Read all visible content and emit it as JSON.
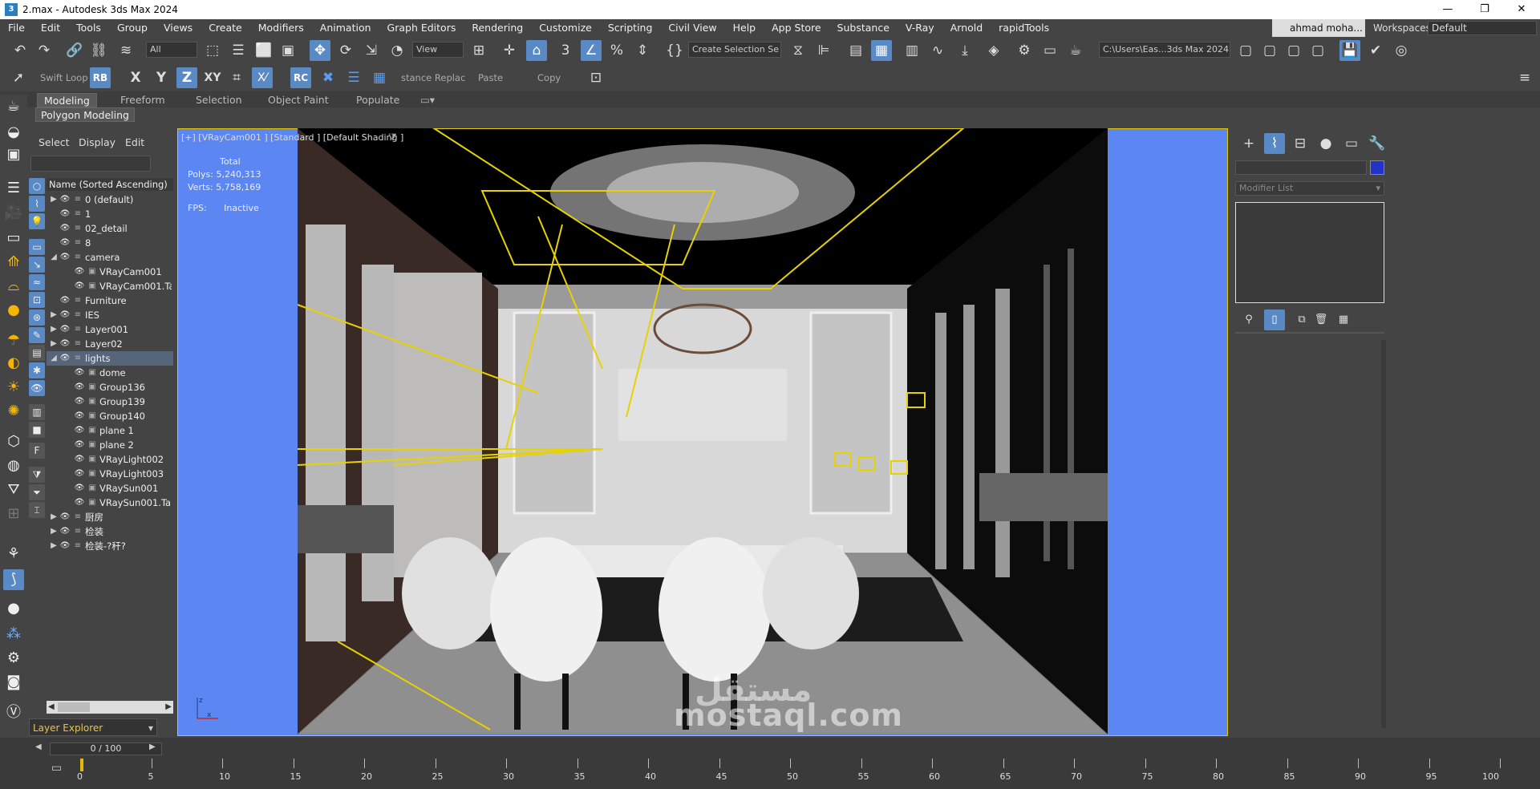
{
  "window": {
    "title": "2.max - Autodesk 3ds Max 2024",
    "app_icon": "3ds-max-icon",
    "controls": [
      "—",
      "❐",
      "✕"
    ]
  },
  "menu": {
    "items": [
      "File",
      "Edit",
      "Tools",
      "Group",
      "Views",
      "Create",
      "Modifiers",
      "Animation",
      "Graph Editors",
      "Rendering",
      "Customize",
      "Scripting",
      "Civil View",
      "Help",
      "App Store",
      "Substance",
      "V-Ray",
      "Arnold",
      "rapidTools"
    ],
    "user": "ahmad moha...",
    "workspaces_label": "Workspaces:",
    "workspace_value": "Default"
  },
  "main_toolbar": {
    "selection_filter": "All",
    "ref_coord": "View",
    "named_selection": "Create Selection Se",
    "project_path": "C:\\Users\\Eas...3ds Max 2024"
  },
  "second_toolbar": {
    "swift_loop": "Swift Loop",
    "rb_label": "RB",
    "x_label": "X",
    "y_label": "Y",
    "z_label": "Z",
    "xy_label": "XY",
    "rc_label": "RC",
    "instance_replace": "stance Replac",
    "paste": "Paste",
    "copy": "Copy"
  },
  "ribbon": {
    "tabs": [
      "Modeling",
      "Freeform",
      "Selection",
      "Object Paint",
      "Populate"
    ],
    "active_tab": "Modeling",
    "sub_panel": "Polygon Modeling"
  },
  "explorer": {
    "menu": [
      "Select",
      "Display",
      "Edit"
    ],
    "header": "Name (Sorted Ascending)",
    "rows": [
      {
        "label": "0 (default)",
        "depth": 0,
        "arrow": "▶"
      },
      {
        "label": "1",
        "depth": 0,
        "arrow": ""
      },
      {
        "label": "02_detail",
        "depth": 0,
        "arrow": ""
      },
      {
        "label": "8",
        "depth": 0,
        "arrow": ""
      },
      {
        "label": "camera",
        "depth": 0,
        "arrow": "◢"
      },
      {
        "label": "VRayCam001",
        "depth": 1,
        "arrow": ""
      },
      {
        "label": "VRayCam001.Tar",
        "depth": 1,
        "arrow": ""
      },
      {
        "label": "Furniture",
        "depth": 0,
        "arrow": ""
      },
      {
        "label": "IES",
        "depth": 0,
        "arrow": "▶"
      },
      {
        "label": "Layer001",
        "depth": 0,
        "arrow": "▶"
      },
      {
        "label": "Layer02",
        "depth": 0,
        "arrow": "▶"
      },
      {
        "label": "lights",
        "depth": 0,
        "arrow": "◢",
        "selected": true
      },
      {
        "label": "dome",
        "depth": 1,
        "arrow": ""
      },
      {
        "label": "Group136",
        "depth": 1,
        "arrow": ""
      },
      {
        "label": "Group139",
        "depth": 1,
        "arrow": ""
      },
      {
        "label": "Group140",
        "depth": 1,
        "arrow": ""
      },
      {
        "label": "plane 1",
        "depth": 1,
        "arrow": ""
      },
      {
        "label": "plane 2",
        "depth": 1,
        "arrow": ""
      },
      {
        "label": "VRayLight002",
        "depth": 1,
        "arrow": ""
      },
      {
        "label": "VRayLight003",
        "depth": 1,
        "arrow": ""
      },
      {
        "label": "VRaySun001",
        "depth": 1,
        "arrow": ""
      },
      {
        "label": "VRaySun001.Targ",
        "depth": 1,
        "arrow": ""
      },
      {
        "label": "厨房",
        "depth": 0,
        "arrow": "▶"
      },
      {
        "label": "检装",
        "depth": 0,
        "arrow": "▶"
      },
      {
        "label": "检装-?秆?",
        "depth": 0,
        "arrow": "▶"
      }
    ],
    "footer": "Layer Explorer"
  },
  "viewport": {
    "label": "[+] [VRayCam001 ] [Standard ] [Default Shading ]",
    "stats_title": "Total",
    "polys_label": "Polys:",
    "polys_value": "5,240,313",
    "verts_label": "Verts:",
    "verts_value": "5,758,169",
    "fps_label": "FPS:",
    "fps_value": "Inactive",
    "border_color": "#e6c600",
    "background_color": "#5c86f2"
  },
  "right_panel": {
    "modifier_list": "Modifier List",
    "color_swatch": "#2233cc"
  },
  "timeline": {
    "frame_display": "0 / 100",
    "ticks": [
      "0",
      "5",
      "10",
      "15",
      "20",
      "25",
      "30",
      "35",
      "40",
      "45",
      "50",
      "55",
      "60",
      "65",
      "70",
      "75",
      "80",
      "85",
      "90",
      "95",
      "100"
    ]
  },
  "watermark": {
    "arabic": "مستقل",
    "latin": "mostaql.com"
  }
}
